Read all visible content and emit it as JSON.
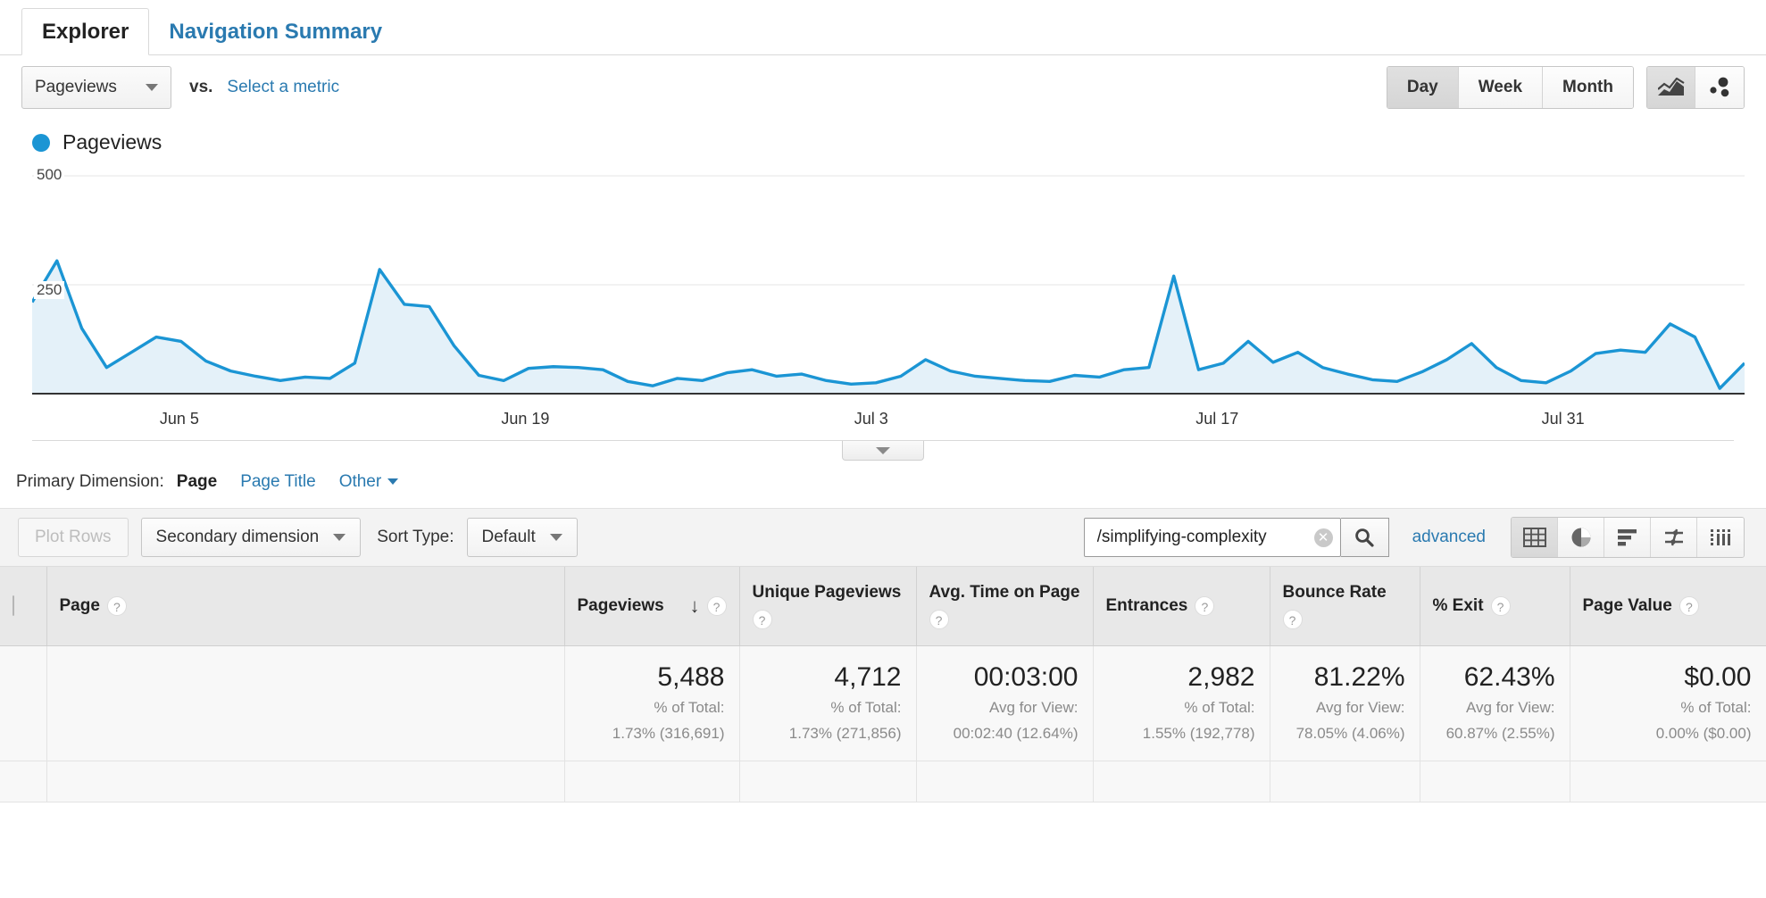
{
  "tabs": [
    {
      "label": "Explorer",
      "active": true
    },
    {
      "label": "Navigation Summary",
      "active": false
    }
  ],
  "metric_selector": {
    "selected": "Pageviews",
    "vs_label": "vs.",
    "compare_link": "Select a metric"
  },
  "granularity": {
    "options": [
      "Day",
      "Week",
      "Month"
    ],
    "selected": "Day"
  },
  "chart_type_buttons": [
    {
      "icon": "line-chart-icon",
      "selected": true
    },
    {
      "icon": "motion-chart-icon",
      "selected": false
    }
  ],
  "legend": {
    "label": "Pageviews",
    "color": "#1b95d4"
  },
  "primary_dimension": {
    "label": "Primary Dimension:",
    "active": "Page",
    "links": [
      "Page Title"
    ],
    "other": "Other"
  },
  "toolbar": {
    "plot_rows": "Plot Rows",
    "secondary_dimension": "Secondary dimension",
    "sort_type_label": "Sort Type:",
    "sort_type_value": "Default",
    "search_value": "/simplifying-complexity",
    "advanced": "advanced",
    "view_icons": [
      {
        "icon": "table-view-icon",
        "selected": true
      },
      {
        "icon": "pie-view-icon",
        "selected": false
      },
      {
        "icon": "bar-view-icon",
        "selected": false
      },
      {
        "icon": "comparison-view-icon",
        "selected": false
      },
      {
        "icon": "pivot-view-icon",
        "selected": false
      }
    ]
  },
  "table": {
    "columns": [
      {
        "label": "Page",
        "help": "?"
      },
      {
        "label": "Pageviews",
        "help": "?",
        "sorted": "desc",
        "sort_glyph": "↓"
      },
      {
        "label": "Unique Pageviews",
        "help": "?"
      },
      {
        "label": "Avg. Time on Page",
        "help": "?"
      },
      {
        "label": "Entrances",
        "help": "?"
      },
      {
        "label": "Bounce Rate",
        "help": "?"
      },
      {
        "label": "% Exit",
        "help": "?"
      },
      {
        "label": "Page Value",
        "help": "?"
      }
    ],
    "summary_row": [
      {
        "value": "5,488",
        "meta_label": "% of Total:",
        "meta_value": "1.73% (316,691)"
      },
      {
        "value": "4,712",
        "meta_label": "% of Total:",
        "meta_value": "1.73% (271,856)"
      },
      {
        "value": "00:03:00",
        "meta_label": "Avg for View:",
        "meta_value": "00:02:40 (12.64%)"
      },
      {
        "value": "2,982",
        "meta_label": "% of Total:",
        "meta_value": "1.55% (192,778)"
      },
      {
        "value": "81.22%",
        "meta_label": "Avg for View:",
        "meta_value": "78.05% (4.06%)"
      },
      {
        "value": "62.43%",
        "meta_label": "Avg for View:",
        "meta_value": "60.87% (2.55%)"
      },
      {
        "value": "$0.00",
        "meta_label": "% of Total:",
        "meta_value": "0.00% ($0.00)"
      }
    ]
  },
  "chart_data": {
    "type": "area",
    "title": "Pageviews",
    "xlabel": "",
    "ylabel": "Pageviews",
    "ylim": [
      0,
      500
    ],
    "yticks": [
      250,
      500
    ],
    "ytick_labels": [
      "250",
      "500"
    ],
    "grid": true,
    "legend_position": "top-left",
    "series": [
      {
        "name": "Pageviews",
        "color": "#1b95d4",
        "fill": "#e4f1f9",
        "values": [
          210,
          305,
          150,
          60,
          95,
          130,
          120,
          75,
          52,
          40,
          30,
          38,
          35,
          70,
          285,
          205,
          200,
          110,
          42,
          30,
          58,
          62,
          60,
          55,
          28,
          18,
          35,
          30,
          48,
          55,
          40,
          45,
          30,
          22,
          25,
          40,
          78,
          52,
          40,
          35,
          30,
          28,
          42,
          38,
          55,
          60,
          270,
          55,
          70,
          120,
          72,
          95,
          60,
          45,
          32,
          28,
          50,
          78,
          115,
          60,
          30,
          25,
          52,
          92,
          100,
          95,
          160,
          130,
          12,
          70
        ]
      }
    ],
    "x_tick_labels": [
      "Jun 5",
      "Jun 19",
      "Jul 3",
      "Jul 17",
      "Jul 31"
    ],
    "x_tick_positions_pct": [
      8.6,
      28.8,
      49.0,
      69.2,
      89.4
    ]
  }
}
